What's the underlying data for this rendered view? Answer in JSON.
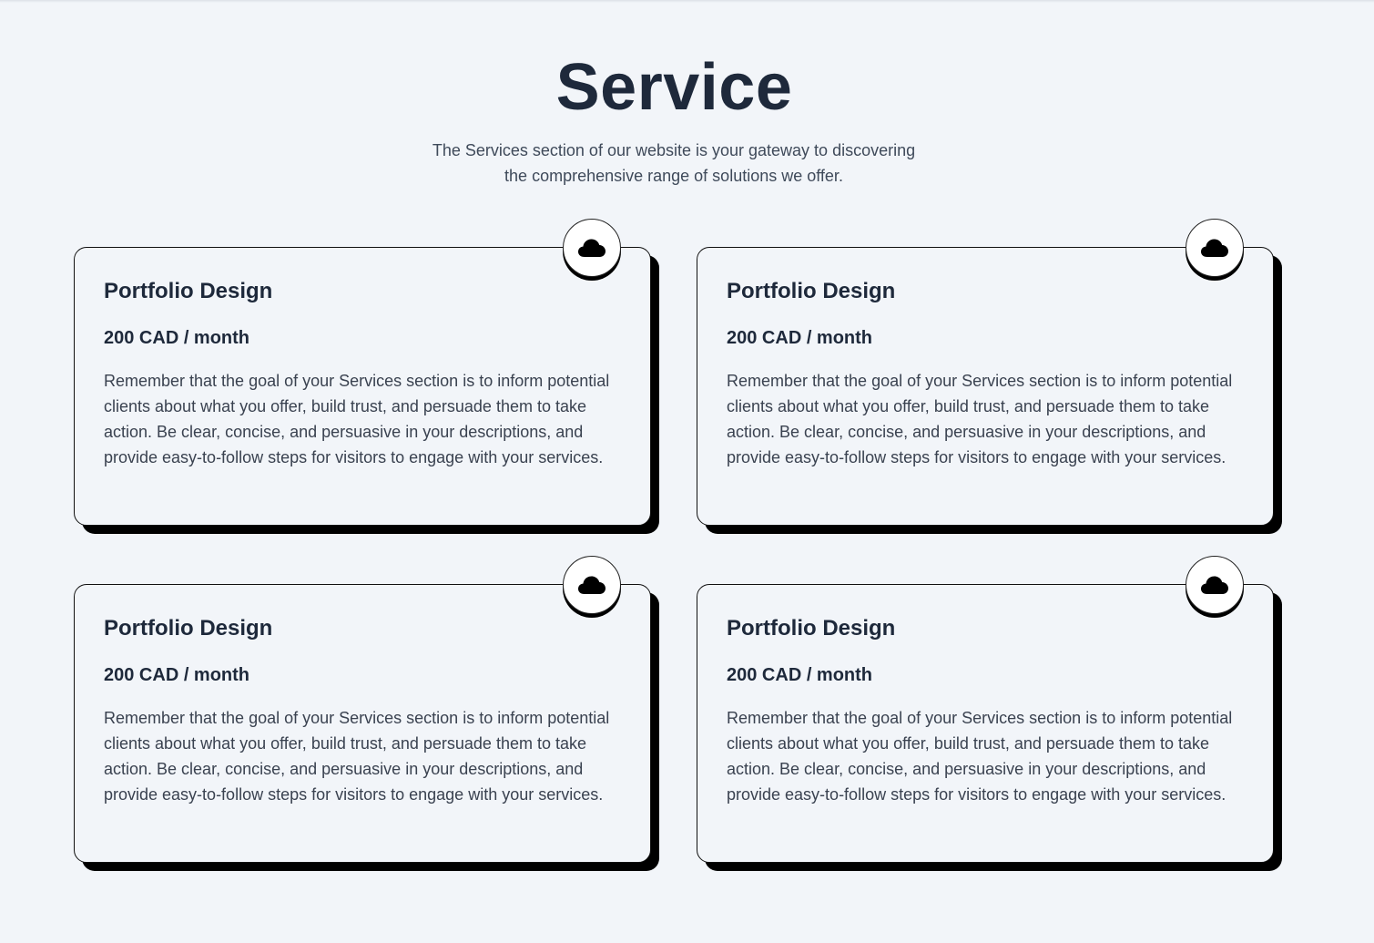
{
  "header": {
    "title": "Service",
    "subtitle": "The Services section of our website is your gateway to discovering the comprehensive range of solutions we offer."
  },
  "colors": {
    "background": "#f2f5f9",
    "heading": "#1e293b",
    "body_text": "#3a4250",
    "shadow": "#000000"
  },
  "cards": [
    {
      "icon": "cloud-icon",
      "title": "Portfolio Design",
      "price": "200 CAD / month",
      "description": "Remember that the goal of your Services section is to inform potential clients about what you offer, build trust, and persuade them to take action. Be clear, concise, and persuasive in your descriptions, and provide easy-to-follow steps for visitors to engage with your services."
    },
    {
      "icon": "cloud-icon",
      "title": "Portfolio Design",
      "price": "200 CAD / month",
      "description": "Remember that the goal of your Services section is to inform potential clients about what you offer, build trust, and persuade them to take action. Be clear, concise, and persuasive in your descriptions, and provide easy-to-follow steps for visitors to engage with your services."
    },
    {
      "icon": "cloud-icon",
      "title": "Portfolio Design",
      "price": "200 CAD / month",
      "description": "Remember that the goal of your Services section is to inform potential clients about what you offer, build trust, and persuade them to take action. Be clear, concise, and persuasive in your descriptions, and provide easy-to-follow steps for visitors to engage with your services."
    },
    {
      "icon": "cloud-icon",
      "title": "Portfolio Design",
      "price": "200 CAD / month",
      "description": "Remember that the goal of your Services section is to inform potential clients about what you offer, build trust, and persuade them to take action. Be clear, concise, and persuasive in your descriptions, and provide easy-to-follow steps for visitors to engage with your services."
    }
  ]
}
